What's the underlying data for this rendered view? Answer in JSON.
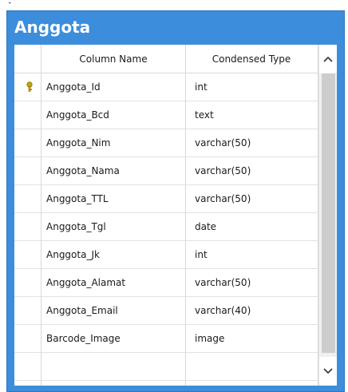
{
  "corner_mark": "ˇ",
  "window": {
    "title": "Anggota"
  },
  "columns": {
    "name_header": "Column Name",
    "type_header": "Condensed Type"
  },
  "rows": [
    {
      "name": "Anggota_Id",
      "type": "int",
      "primary_key": true
    },
    {
      "name": "Anggota_Bcd",
      "type": "text",
      "primary_key": false
    },
    {
      "name": "Anggota_Nim",
      "type": "varchar(50)",
      "primary_key": false
    },
    {
      "name": "Anggota_Nama",
      "type": "varchar(50)",
      "primary_key": false
    },
    {
      "name": "Anggota_TTL",
      "type": "varchar(50)",
      "primary_key": false
    },
    {
      "name": "Anggota_Tgl",
      "type": "date",
      "primary_key": false
    },
    {
      "name": "Anggota_Jk",
      "type": "int",
      "primary_key": false
    },
    {
      "name": "Anggota_Alamat",
      "type": "varchar(50)",
      "primary_key": false
    },
    {
      "name": "Anggota_Email",
      "type": "varchar(40)",
      "primary_key": false
    },
    {
      "name": "Barcode_Image",
      "type": "image",
      "primary_key": false
    },
    {
      "name": "",
      "type": "",
      "primary_key": false
    }
  ],
  "icons": {
    "primary_key": "key-icon",
    "scroll_up": "chevron-up-icon",
    "scroll_down": "chevron-down-icon"
  },
  "colors": {
    "title_bar": "#3c8ddb",
    "key": "#c9a400"
  }
}
